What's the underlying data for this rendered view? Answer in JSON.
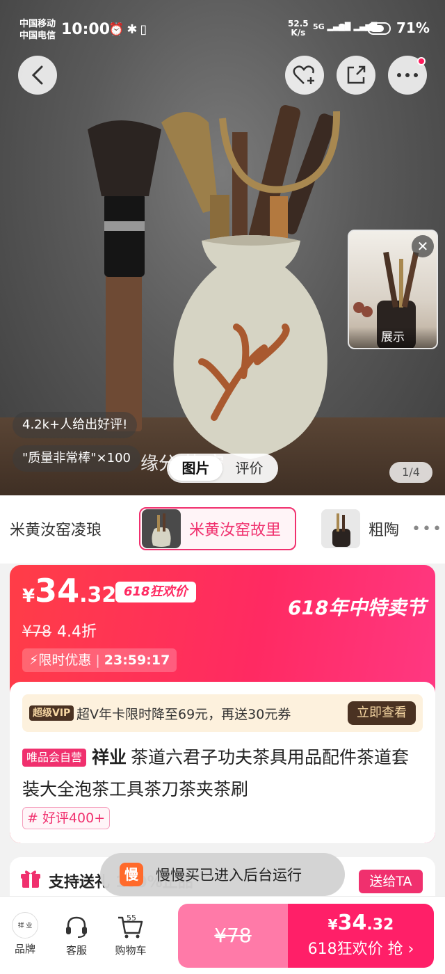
{
  "status_bar": {
    "carrier_1": "中国移动",
    "carrier_2": "中国电信",
    "time": "10:00",
    "net_speed": "52.5",
    "net_unit": "K/s",
    "signal_1": "5G",
    "signal_2": "5G",
    "battery": "71%"
  },
  "hero": {
    "inset_label": "展示",
    "review_count": "4.2k+人给出好评!",
    "review_quote": "\"质量非常棒\"×100",
    "overlay_text": "缘分 茶 空",
    "tabs": [
      "图片",
      "评价"
    ],
    "active_tab": 0,
    "counter": "1/4"
  },
  "variants": [
    {
      "label": "米黄汝窑凌琅",
      "active": false
    },
    {
      "label": "米黄汝窑故里",
      "active": true
    },
    {
      "label": "粗陶",
      "active": false
    }
  ],
  "price": {
    "yen": "¥",
    "integer": "34",
    "decimal": ".32",
    "festival_tag": "618狂欢价",
    "festival_title": "618年中特卖节",
    "original": "¥78",
    "discount": "4.4折",
    "limited_label": "限时优惠",
    "countdown": "23:59:17"
  },
  "vip": {
    "badge": "超级VIP",
    "text": "超V年卡限时降至69元，再送30元券",
    "button": "立即查看"
  },
  "product": {
    "store_tag": "唯品会自营",
    "brand": "祥业",
    "title": "茶道六君子功夫茶具用品配件茶道套装大全泡茶工具茶刀茶夹茶刷",
    "review_tag": "# 好评400+"
  },
  "gift": {
    "text": "支持送礼 100%正品",
    "button": "送给TA"
  },
  "toast": {
    "icon_text": "慢",
    "text": "慢慢买已进入后台运行"
  },
  "bottom_bar": {
    "brand_label": "品牌",
    "brand_logo_text": "祥 业",
    "service_label": "客服",
    "cart_label": "购物车",
    "cart_count": "55",
    "buy_original": "¥78",
    "buy_yen": "¥",
    "buy_integer": "34",
    "buy_decimal": ".32",
    "buy_label": "618狂欢价 抢"
  },
  "colors": {
    "accent": "#f0306e",
    "price_gradient_start": "#ff3d47",
    "price_gradient_end": "#ff3a86",
    "vip_dark": "#4a3222"
  }
}
